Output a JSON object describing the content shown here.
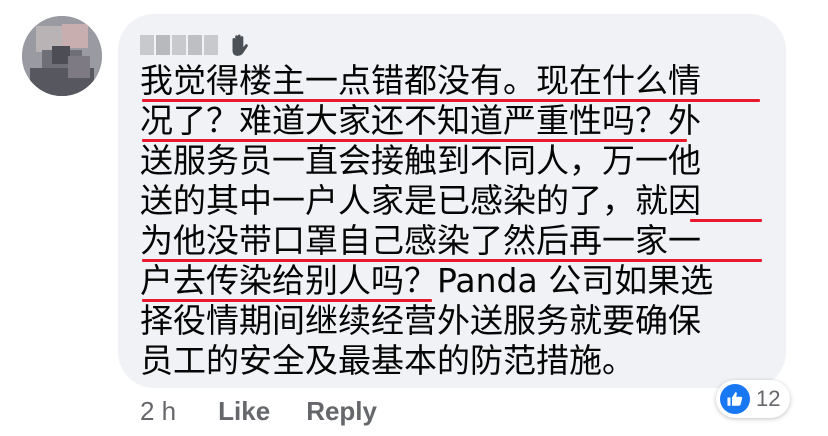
{
  "comment": {
    "lines": [
      "我觉得楼主一点错都没有。现在什么情",
      "况了？难道大家还不知道严重性吗？外",
      "送服务员一直会接触到不同人，万一他",
      "送的其中一户人家是已感染的了，就因",
      "为他没带口罩自己感染了然后再一家一",
      "户去传染给别人吗？Panda 公司如果选",
      "择役情期间继续经营外送服务就要确保",
      "员工的安全及最基本的防范措施。"
    ]
  },
  "author": {
    "name_icon": "wave-icon"
  },
  "actions": {
    "timestamp": "2 h",
    "like_label": "Like",
    "reply_label": "Reply"
  },
  "reactions": {
    "icon": "like-icon",
    "count": "12"
  },
  "colors": {
    "bubble": "#f0f2f5",
    "underline": "#e8192c",
    "like_blue": "#1877f2",
    "meta_text": "#65676b"
  }
}
